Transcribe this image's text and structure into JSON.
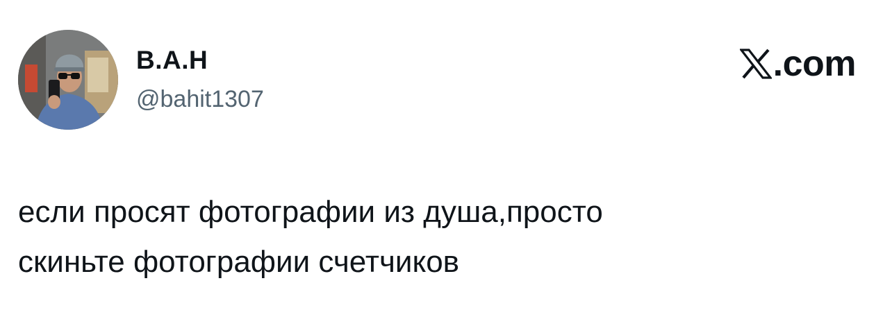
{
  "author": {
    "display_name": "В.А.Н",
    "handle": "@bahit1307",
    "avatar_icon": "profile-photo"
  },
  "brand": {
    "icon": "x-logo-icon",
    "text": ".com"
  },
  "tweet": {
    "lines": [
      "если просят фотографии из душа,просто",
      "скиньте фотографии счетчиков"
    ]
  },
  "colors": {
    "text": "#0f1419",
    "secondary": "#536471",
    "background": "#ffffff"
  }
}
